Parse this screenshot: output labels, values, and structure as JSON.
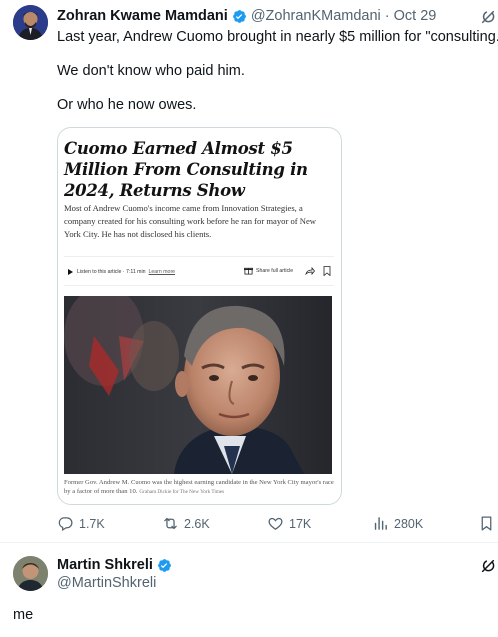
{
  "tweet": {
    "author_name": "Zohran Kwame Mamdani",
    "handle": "@ZohranKMamdani",
    "separator": "·",
    "date": "Oct 29",
    "lines": [
      "Last year, Andrew Cuomo brought in nearly $5 million for \"consulting.\"",
      "We don't know who paid him.",
      "Or who he now owes."
    ],
    "article": {
      "headline": "Cuomo Earned Almost $5 Million From Consulting in 2024, Returns Show",
      "summary": "Most of Andrew Cuomo's income came from Innovation Strategies, a company created for his consulting work before he ran for mayor of New York City. He has not disclosed his clients.",
      "listen_label": "Listen to this article · 7:11 min",
      "learn_more": "Learn more",
      "share_label": "Share full article",
      "caption": "Former Gov. Andrew M. Cuomo was the highest earning candidate in the New York City mayor's race by a factor of more than 10.",
      "credit": "Graham Dickie for The New York Times"
    },
    "stats": {
      "replies": "1.7K",
      "reposts": "2.6K",
      "likes": "17K",
      "views": "280K"
    }
  },
  "reply": {
    "author_name": "Martin Shkreli",
    "handle": "@MartinShkreli",
    "text": "me"
  },
  "colors": {
    "verified": "#1d9bf0",
    "secondary_text": "#536471",
    "primary_text": "#0f1419",
    "border": "#cfd9de"
  },
  "icons": [
    "verified-badge-icon",
    "grok-icon",
    "reply-icon",
    "repost-icon",
    "like-icon",
    "views-icon",
    "bookmark-icon",
    "play-icon",
    "gift-icon",
    "share-arrow-icon"
  ]
}
